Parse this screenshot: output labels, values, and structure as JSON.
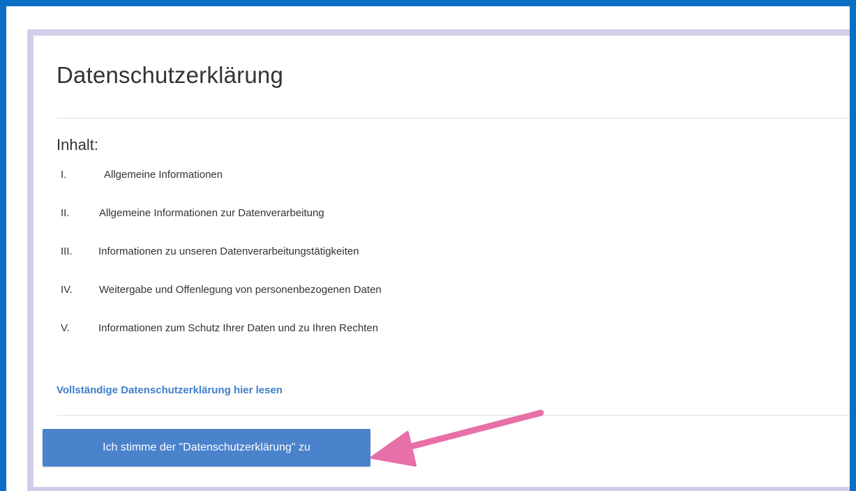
{
  "modal": {
    "title": "Datenschutzerklärung",
    "content_heading": "Inhalt:",
    "toc": [
      {
        "num": "I.",
        "label": "Allgemeine Informationen"
      },
      {
        "num": "II.",
        "label": "Allgemeine Informationen zur Datenverarbeitung"
      },
      {
        "num": "III.",
        "label": "Informationen zu unseren Datenverarbeitungstätigkeiten"
      },
      {
        "num": "IV.",
        "label": "Weitergabe und Offenlegung von personenbezogenen Daten"
      },
      {
        "num": "V.",
        "label": "Informationen zum Schutz Ihrer Daten und zu Ihren Rechten"
      }
    ],
    "full_link": "Vollständige Datenschutzerklärung hier lesen",
    "accept_button": "Ich stimme der \"Datenschutzerklärung\" zu"
  },
  "colors": {
    "frame_border": "#0a6fc2",
    "modal_border": "#d2cde8",
    "link": "#3f7fcb",
    "button": "#4a82cc",
    "arrow": "#e86fa8"
  }
}
